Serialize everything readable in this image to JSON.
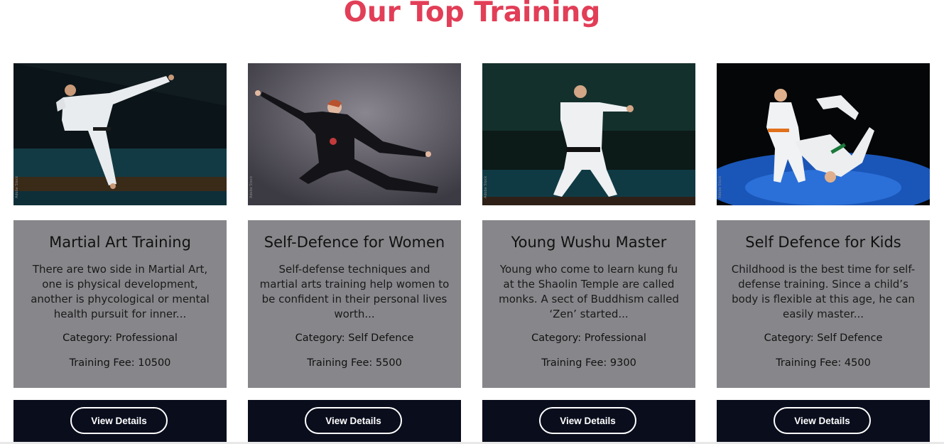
{
  "page": {
    "title": "Our Top Training"
  },
  "trainings": [
    {
      "title": "Martial Art Training",
      "description": "There are two side in Martial Art, one is physical development, another is phycological or mental health pursuit for inner...",
      "category_label": "Category: Professional",
      "fee_label": "Training Fee: 10500",
      "button_label": "View Details",
      "image_icon": "karate-kick-photo"
    },
    {
      "title": "Self-Defence for Women",
      "description": "Self-defense techniques and martial arts training help women to be confident in their personal lives worth...",
      "category_label": "Category: Self Defence",
      "fee_label": "Training Fee: 5500",
      "button_label": "View Details",
      "image_icon": "kungfu-stance-photo"
    },
    {
      "title": "Young Wushu Master",
      "description": "Young who come to learn kung fu at the Shaolin Temple are called monks. A sect of Buddhism called ‘Zen’ started...",
      "category_label": "Category: Professional",
      "fee_label": "Training Fee: 9300",
      "button_label": "View Details",
      "image_icon": "karate-punch-photo"
    },
    {
      "title": "Self Defence for Kids",
      "description": "Childhood is the best time for self-defense training. Since a child’s body is flexible at this age, he can easily master...",
      "category_label": "Category: Self Defence",
      "fee_label": "Training Fee: 4500",
      "button_label": "View Details",
      "image_icon": "kids-judo-throw-photo"
    }
  ],
  "colors": {
    "title_accent": "#e23e57",
    "card_body_bg": "#87878b",
    "card_footer_bg": "#090d1c",
    "button_border": "#ffffff"
  }
}
